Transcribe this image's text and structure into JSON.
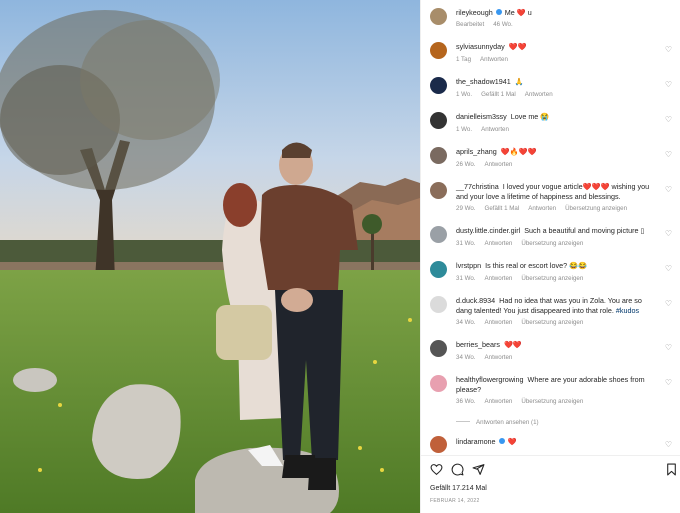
{
  "post": {
    "author": "rileykeough",
    "caption": "Me",
    "caption_emoji": "❤️",
    "caption_suffix": "u",
    "edited": "Bearbeitet",
    "age": "46 Wo."
  },
  "comments": [
    {
      "user": "sylviasunnyday",
      "text": "❤️❤️",
      "meta": [
        "1 Tag",
        "Antworten"
      ],
      "avatar_color": "#b5651d"
    },
    {
      "user": "the_shadow1941",
      "text": "🙏",
      "meta": [
        "1 Wo.",
        "Gefällt 1 Mal",
        "Antworten"
      ],
      "avatar_color": "#1a2a4a"
    },
    {
      "user": "danielleism3ssy",
      "text": "Love me 😭",
      "meta": [
        "1 Wo.",
        "Antworten"
      ],
      "avatar_color": "#333333"
    },
    {
      "user": "aprils_zhang",
      "text": "❤️🔥❤️❤️",
      "meta": [
        "26 Wo.",
        "Antworten"
      ],
      "avatar_color": "#7a6a60"
    },
    {
      "user": "__77christina",
      "text": "I loved your vogue article❤️❤️❤️ wishing you and your love a lifetime of happiness and blessings.",
      "meta": [
        "29 Wo.",
        "Gefällt 1 Mal",
        "Antworten",
        "Übersetzung anzeigen"
      ],
      "avatar_color": "#8a6d5a"
    },
    {
      "user": "dusty.little.cinder.girl",
      "text": "Such a beautiful and moving picture ▯",
      "meta": [
        "31 Wo.",
        "Antworten",
        "Übersetzung anzeigen"
      ],
      "avatar_color": "#9aa0a6"
    },
    {
      "user": "lvrstppn",
      "text": "Is this real or escort love? 😂😂",
      "meta": [
        "31 Wo.",
        "Antworten",
        "Übersetzung anzeigen"
      ],
      "avatar_color": "#2e8b9a"
    },
    {
      "user": "d.duck.8934",
      "text": "Had no idea that was you in Zola. You are so dang talented! You just disappeared into that role.",
      "hashtag": "#kudos",
      "meta": [
        "34 Wo.",
        "Antworten",
        "Übersetzung anzeigen"
      ],
      "avatar_color": "#dbdbdb"
    },
    {
      "user": "berries_bears",
      "text": "❤️❤️",
      "meta": [
        "34 Wo.",
        "Antworten"
      ],
      "avatar_color": "#555555"
    },
    {
      "user": "healthyflowergrowing",
      "text": "Where are your adorable shoes from please?",
      "meta": [
        "36 Wo.",
        "Antworten",
        "Übersetzung anzeigen"
      ],
      "avatar_color": "#e8a0b0"
    },
    {
      "user": "lindaramone",
      "text": "❤️",
      "meta": [],
      "avatar_color": "#c0603a"
    }
  ],
  "view_replies": "Antworten ansehen (1)",
  "likes": "Gefällt 17.214 Mal",
  "date": "FEBRUAR 14, 2022",
  "icons": {
    "like": "heart-icon",
    "comment": "comment-icon",
    "share": "share-icon",
    "save": "bookmark-icon"
  },
  "colors": {
    "verified": "#3897f0",
    "heart_red": "#ed1c3f",
    "link": "#00376b",
    "meta_gray": "#8e8e8e"
  }
}
